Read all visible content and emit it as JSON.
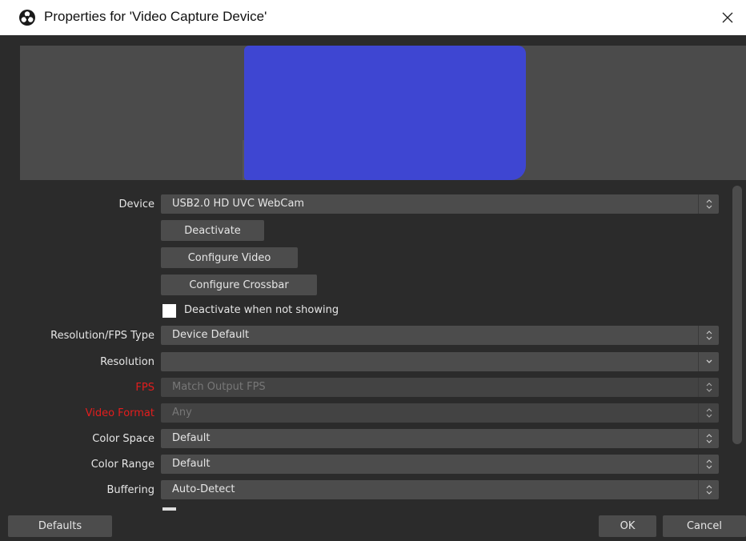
{
  "window": {
    "title": "Properties for 'Video Capture Device'",
    "app_icon": "obs-logo-icon",
    "close_icon": "close-icon"
  },
  "colors": {
    "background": "#2b2b2b",
    "control": "#4c4c4c",
    "preview_blue": "#3e46d2",
    "error_label": "#e41d1d"
  },
  "properties": {
    "device": {
      "label": "Device",
      "value": "USB2.0 HD UVC WebCam"
    },
    "deactivate_button": "Deactivate",
    "configure_video_button": "Configure Video",
    "configure_crossbar_button": "Configure Crossbar",
    "deactivate_when_not_showing": {
      "label": "Deactivate when not showing",
      "checked": false
    },
    "resolution_fps_type": {
      "label": "Resolution/FPS Type",
      "value": "Device Default"
    },
    "resolution": {
      "label": "Resolution",
      "value": ""
    },
    "fps": {
      "label": "FPS",
      "value": "Match Output FPS"
    },
    "video_format": {
      "label": "Video Format",
      "value": "Any"
    },
    "color_space": {
      "label": "Color Space",
      "value": "Default"
    },
    "color_range": {
      "label": "Color Range",
      "value": "Default"
    },
    "buffering": {
      "label": "Buffering",
      "value": "Auto-Detect"
    }
  },
  "footer": {
    "defaults_button": "Defaults",
    "ok_button": "OK",
    "cancel_button": "Cancel"
  }
}
